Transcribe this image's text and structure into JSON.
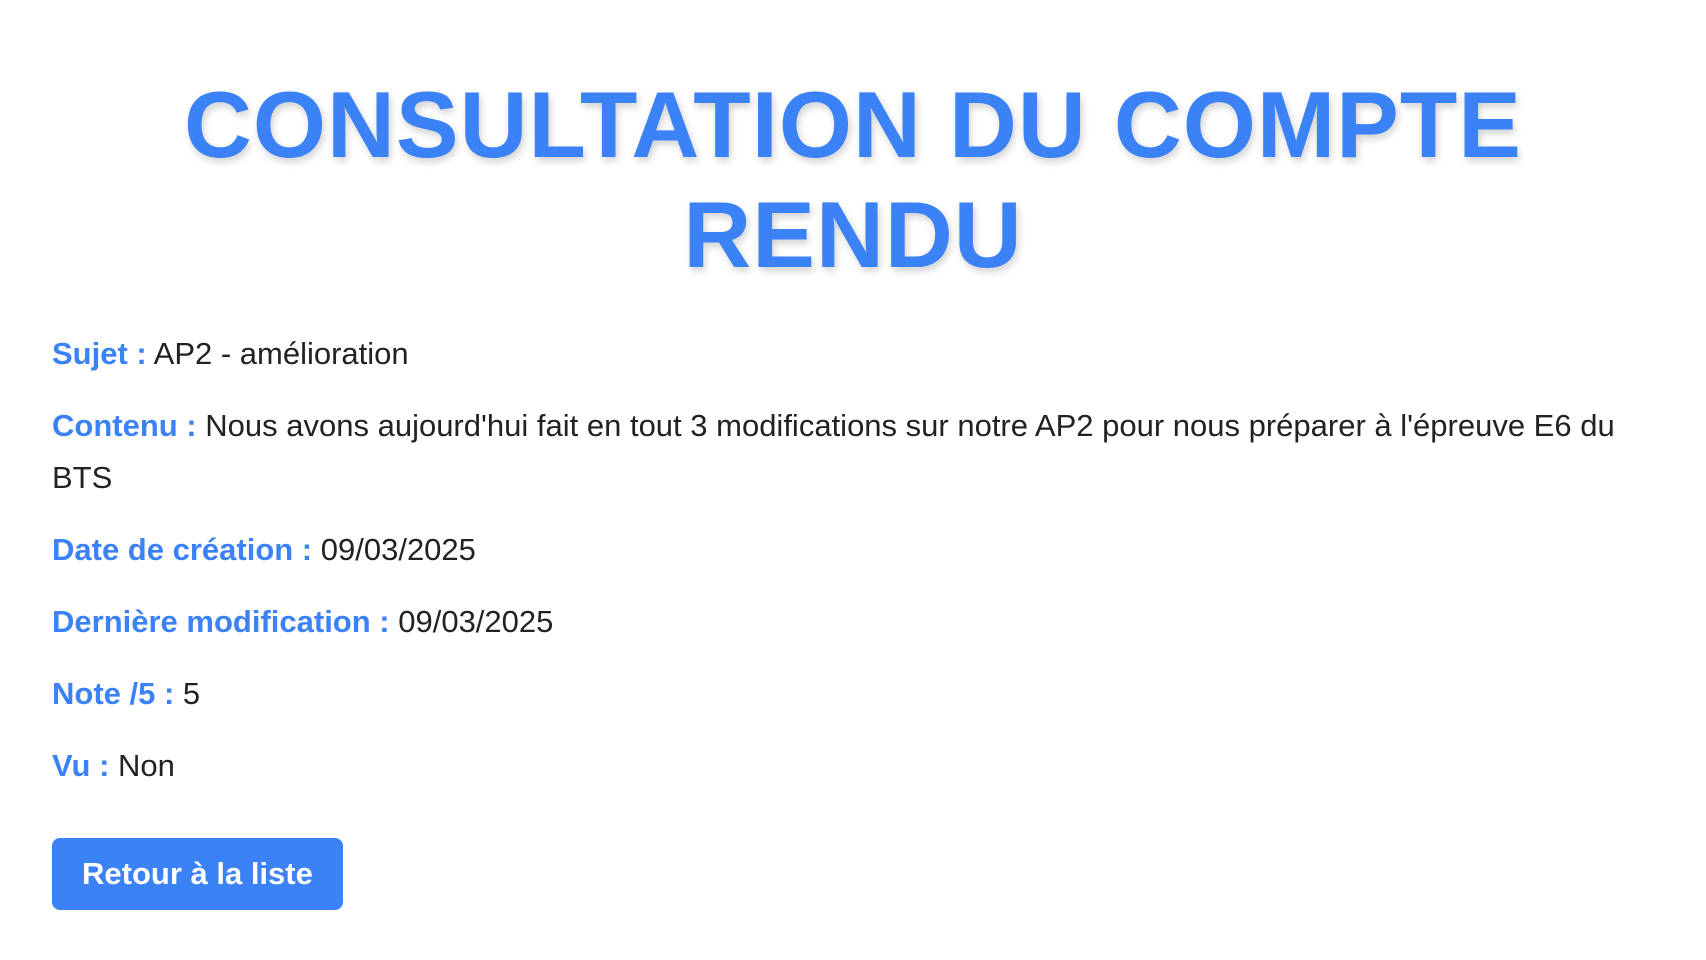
{
  "page": {
    "title": "CONSULTATION DU COMPTE RENDU"
  },
  "fields": {
    "sujet": {
      "label": "Sujet :",
      "value": "AP2 - amélioration"
    },
    "contenu": {
      "label": "Contenu :",
      "value": "Nous avons aujourd'hui fait en tout 3 modifications sur notre AP2 pour nous préparer à l'épreuve E6 du BTS"
    },
    "date_creation": {
      "label": "Date de création :",
      "value": "09/03/2025"
    },
    "derniere_modification": {
      "label": "Dernière modification :",
      "value": "09/03/2025"
    },
    "note": {
      "label": "Note /5 :",
      "value": "5"
    },
    "vu": {
      "label": "Vu :",
      "value": "Non"
    }
  },
  "actions": {
    "back_label": "Retour à la liste"
  },
  "colors": {
    "accent": "#3b82f6",
    "text": "#222222",
    "background": "#ffffff"
  }
}
